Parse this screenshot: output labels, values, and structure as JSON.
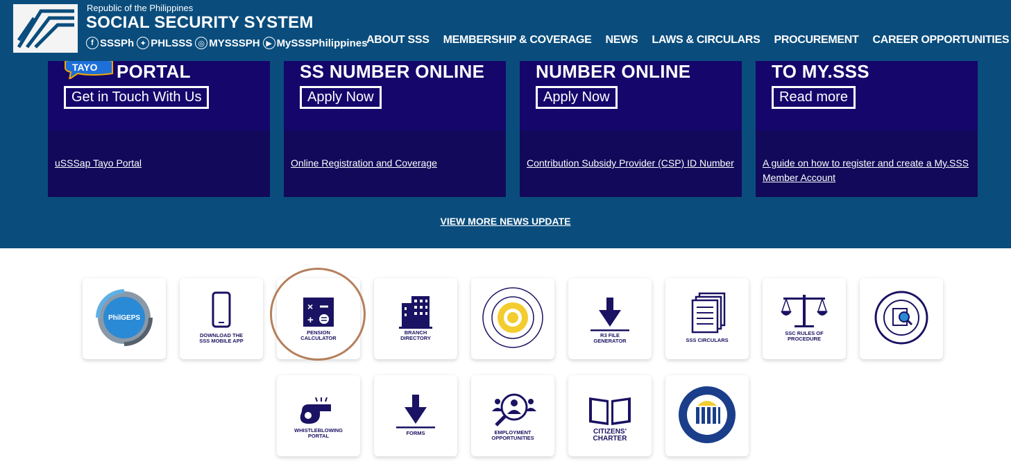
{
  "header": {
    "republic": "Republic of the Philippines",
    "title": "SOCIAL SECURITY SYSTEM",
    "socials": [
      {
        "icon": "facebook-icon",
        "label": "SSSPh"
      },
      {
        "icon": "twitter-icon",
        "label": "PHLSSS"
      },
      {
        "icon": "instagram-icon",
        "label": "MYSSSPH"
      },
      {
        "icon": "youtube-icon",
        "label": "MySSSPhilippines"
      }
    ],
    "nav": [
      "ABOUT SSS",
      "MEMBERSHIP & COVERAGE",
      "NEWS",
      "LAWS & CIRCULARS",
      "PROCUREMENT",
      "CAREER OPPORTUNITIES"
    ]
  },
  "cards": [
    {
      "heading": "PORTAL",
      "badge": "TAYO",
      "button": "Get in Touch With Us",
      "link": "uSSSap Tayo Portal"
    },
    {
      "heading": "SS NUMBER ONLINE",
      "button": "Apply Now",
      "link": "Online Registration and Coverage"
    },
    {
      "heading": "NUMBER ONLINE",
      "button": "Apply Now",
      "link": "Contribution Subsidy Provider (CSP) ID Number"
    },
    {
      "heading": "TO MY.SSS",
      "button": "Read more",
      "link": "A guide on how to register and create a My.SSS Member Account"
    }
  ],
  "view_more": "VIEW MORE NEWS UPDATE",
  "tiles": {
    "philgeps": {
      "text": "PhilGEPS"
    },
    "mobile_app": {
      "line1": "DOWNLOAD THE",
      "line2": "SSS MOBILE APP"
    },
    "pension": {
      "line1": "PENSION",
      "line2": "CALCULATOR"
    },
    "branch": {
      "line1": "BRANCH",
      "line2": "DIRECTORY"
    },
    "r3": {
      "line1": "R3 FILE",
      "line2": "GENERATOR"
    },
    "circulars": {
      "line1": "SSS CIRCULARS"
    },
    "ssc": {
      "line1": "SSC RULES OF",
      "line2": "PROCEDURE"
    },
    "whistle": {
      "line1": "WHISTLEBLOWING",
      "line2": "PORTAL"
    },
    "forms": {
      "line1": "FORMS"
    },
    "employment": {
      "line1": "EMPLOYMENT",
      "line2": "OPPORTUNITIES"
    },
    "citizens": {
      "line1": "CITIZENS'",
      "line2": "CHARTER"
    }
  },
  "colors": {
    "header_bg": "#0a4d7d",
    "card_bg": "#12095a",
    "icon_navy": "#1a1262",
    "highlight": "#b57f5b"
  }
}
